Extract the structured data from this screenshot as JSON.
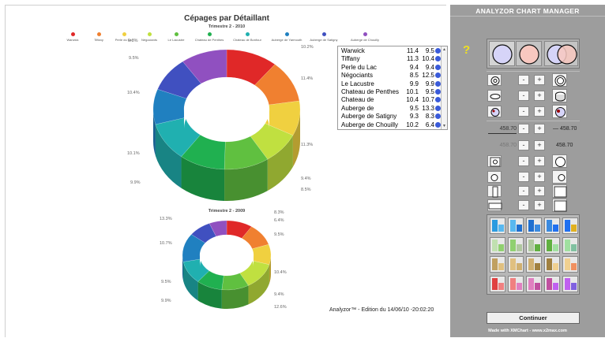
{
  "left": {
    "title": "Cépages par Détaillant",
    "subtitle": "Trimestre 2 - 2010",
    "chart2_title": "Trimestre 2 - 2009",
    "footer": "Analyzor™ -  Edition du 14/06/10 -20:02:20",
    "legend": [
      {
        "label": "Warwick",
        "color": "#e02828"
      },
      {
        "label": "Tiffany",
        "color": "#f08030"
      },
      {
        "label": "Perle du Lac",
        "color": "#f0d040"
      },
      {
        "label": "Négociants",
        "color": "#c0e040"
      },
      {
        "label": "Le Lacustre",
        "color": "#60c040"
      },
      {
        "label": "Chateau de Penthes",
        "color": "#20b050"
      },
      {
        "label": "Chateau de Bonfour",
        "color": "#20b0b0"
      },
      {
        "label": "Auberge de Yarmouth",
        "color": "#2080c0"
      },
      {
        "label": "Auberge de Satigny",
        "color": "#4050c0"
      },
      {
        "label": "Auberge de Chouilly",
        "color": "#9050c0"
      }
    ],
    "pct_labels_top": [
      "9.3%",
      "9.5%",
      "10.2%",
      "11.4%",
      "10.4%",
      "11.3%",
      "10.1%",
      "9.4%",
      "9.9%",
      "8.5%"
    ],
    "pct_labels_bottom": [
      "8.3%",
      "13.3%",
      "6.4%",
      "9.5%",
      "10.7%",
      "10.4%",
      "9.5%",
      "9.4%",
      "9.9%",
      "12.6%"
    ],
    "table": [
      {
        "name": "Warwick",
        "v1": "11.4",
        "v2": "9.5"
      },
      {
        "name": "Tiffany",
        "v1": "11.3",
        "v2": "10.4"
      },
      {
        "name": "Perle du Lac",
        "v1": "9.4",
        "v2": "9.4"
      },
      {
        "name": "Négociants",
        "v1": "8.5",
        "v2": "12.5"
      },
      {
        "name": "Le Lacustre",
        "v1": "9.9",
        "v2": "9.9"
      },
      {
        "name": "Chateau de Penthes",
        "v1": "10.1",
        "v2": "9.5"
      },
      {
        "name": "Chateau de",
        "v1": "10.4",
        "v2": "10.7"
      },
      {
        "name": "Auberge de",
        "v1": "9.5",
        "v2": "13.3"
      },
      {
        "name": "Auberge de Satigny",
        "v1": "9.3",
        "v2": "8.3"
      },
      {
        "name": "Auberge de Chouilly",
        "v1": "10.2",
        "v2": "6.4"
      }
    ]
  },
  "right": {
    "title": "ANALYZOR CHART MANAGER",
    "question": "?",
    "value_1_left": "458.70",
    "value_1_right": "458.70",
    "value_2_left": "458.70",
    "value_2_right": "458.70",
    "minus": "-",
    "plus": "+",
    "button_label": "Continuer",
    "footer": "Made with XMChart - www.x2max.com"
  }
}
